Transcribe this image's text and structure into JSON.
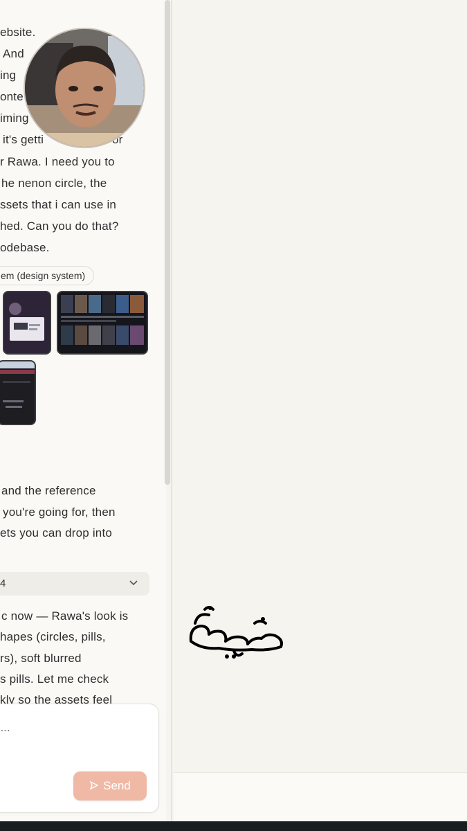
{
  "chat": {
    "message1": [
      "ebsite.",
      "And",
      "ing",
      "onte",
      "iming",
      "it's getti",
      "or",
      "r Rawa. I need you to",
      "he nenon circle, the",
      "ssets that i can use in",
      "hed. Can you do that?",
      "odebase."
    ],
    "tag": "em (design system)",
    "reply1": [
      "and the reference",
      "you're going for, then",
      "ets you can drop into"
    ],
    "collapse_label": "4",
    "reply2": [
      "c now — Rawa's look is",
      "hapes (circles, pills,",
      "rs), soft blurred",
      "s pills. Let me check",
      "kly so the assets feel"
    ]
  },
  "composer": {
    "placeholder": "e...",
    "send_label": "Send"
  },
  "watermark": "معينة",
  "colors": {
    "send_bg": "#f0b9a6",
    "panel_bg": "#faf9f6",
    "canvas_bg": "#f6f4ef"
  }
}
